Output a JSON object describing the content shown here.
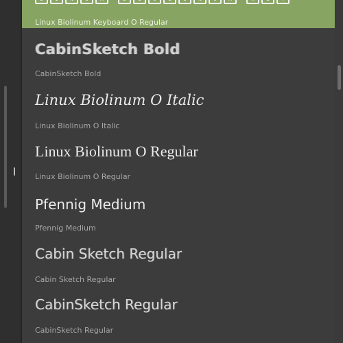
{
  "font_list": {
    "items": [
      {
        "caption": "Linux Biolinum Keyboard O Regular",
        "selected": true,
        "preview_keys": [
          "L",
          "I",
          "N",
          "U",
          "X",
          "B",
          "I",
          "O",
          "L",
          "I",
          "N",
          "U",
          "M",
          "K",
          "E",
          "Y"
        ]
      },
      {
        "preview": "CabinSketch Bold",
        "caption": "CabinSketch Bold"
      },
      {
        "preview": "Linux Biolinum O Italic",
        "caption": "Linux Biolinum O Italic"
      },
      {
        "preview": "Linux Biolinum O Regular",
        "caption": "Linux Biolinum O Regular"
      },
      {
        "preview": "Pfennig Medium",
        "caption": "Pfennig Medium"
      },
      {
        "preview": "Cabin Sketch Regular",
        "caption": "Cabin Sketch Regular"
      },
      {
        "preview": "CabinSketch Regular",
        "caption": "CabinSketch Regular"
      }
    ]
  },
  "colors": {
    "selected_background": "#88a462",
    "list_background": "#3c3c3c",
    "panel_background": "#353535"
  }
}
